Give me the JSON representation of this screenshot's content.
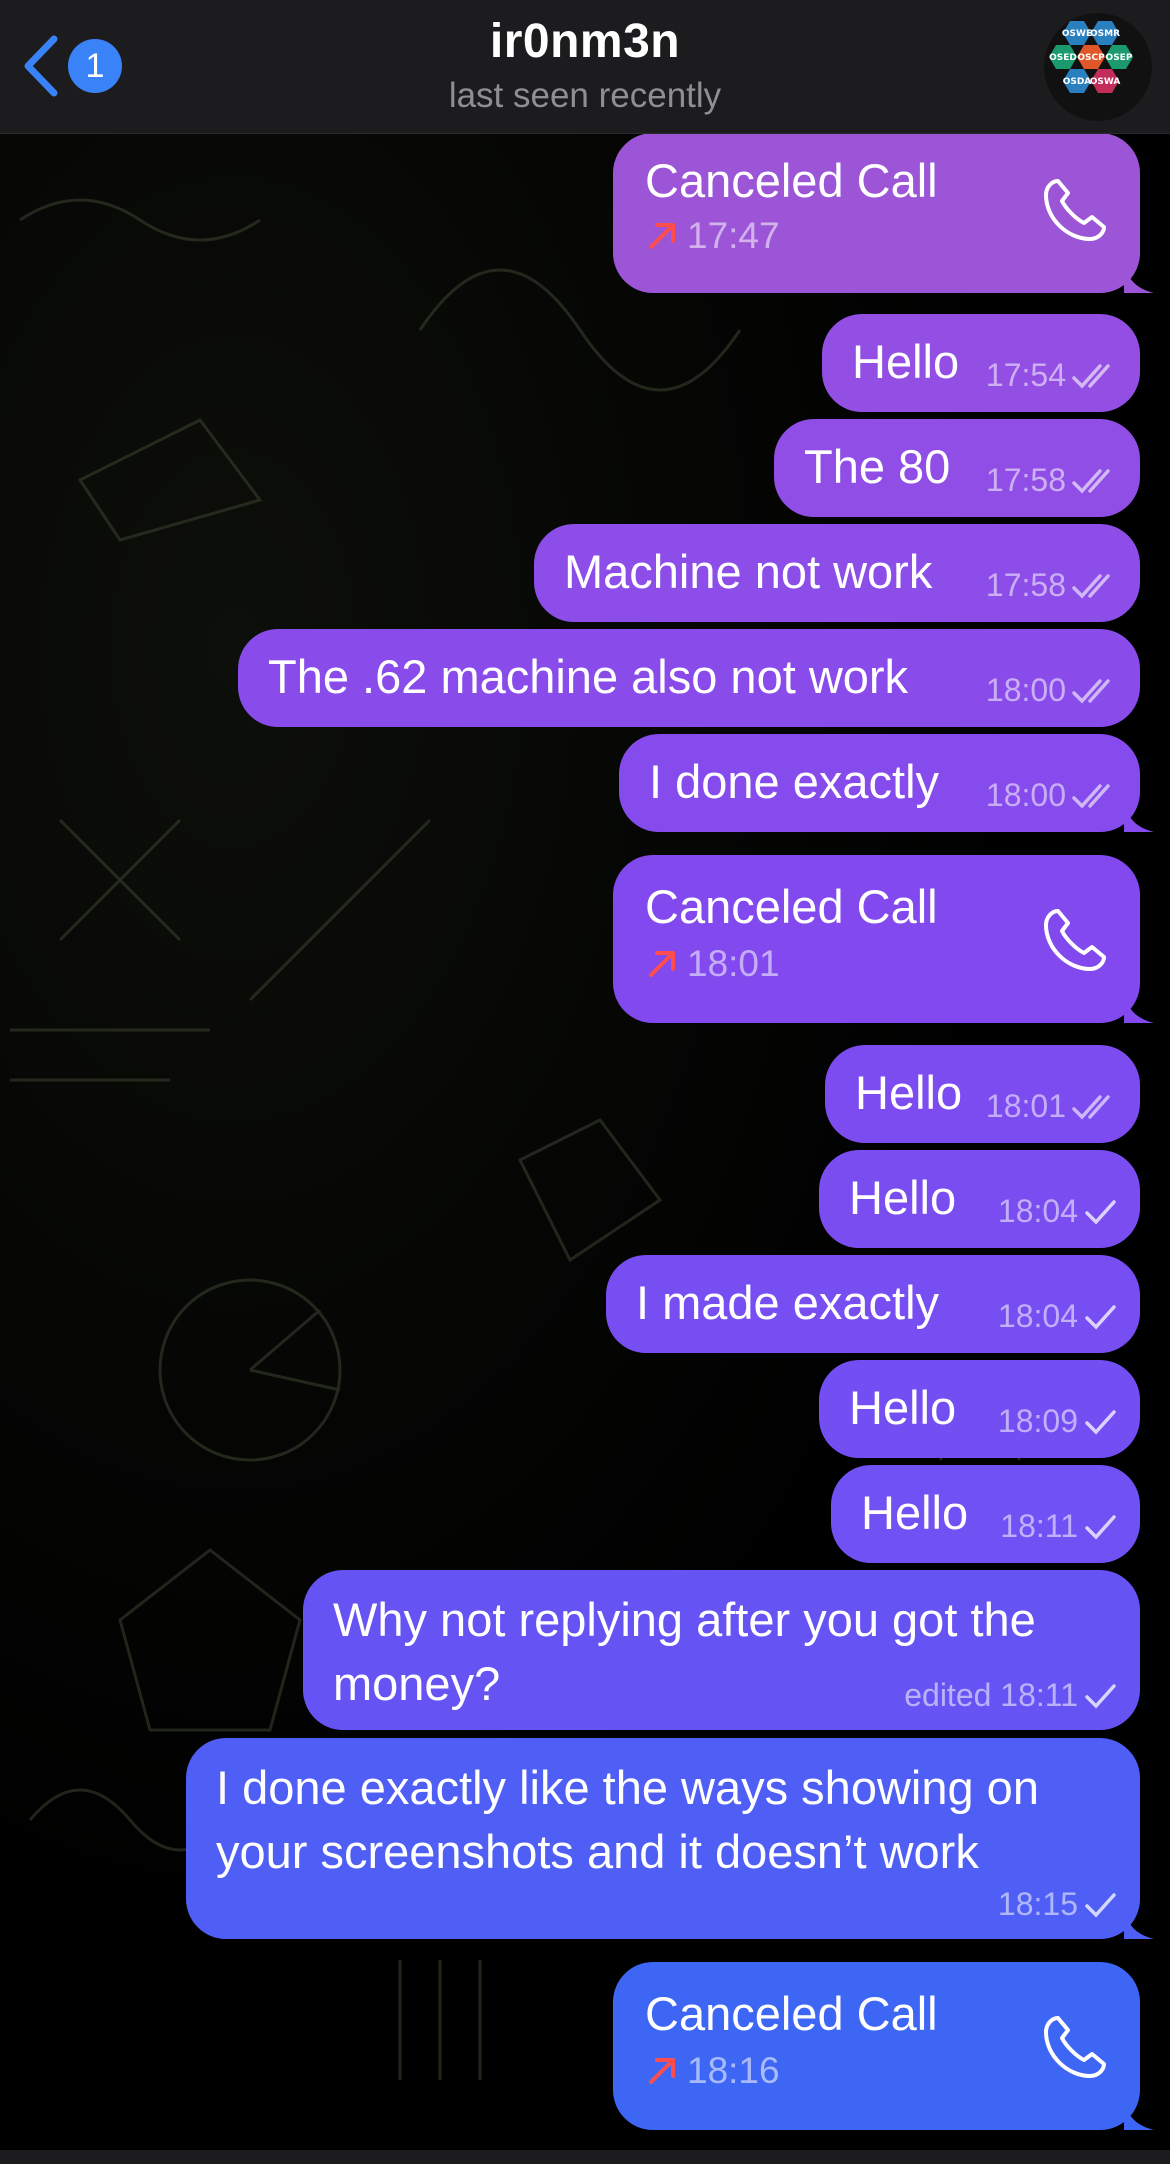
{
  "header": {
    "back_badge": "1",
    "title": "ir0nm3n",
    "subtitle": "last seen recently",
    "avatar_labels": [
      "OSWE",
      "OSMR",
      "OSED",
      "OSCP",
      "OSEP",
      "OSDA",
      "OSWA"
    ]
  },
  "messages": [
    {
      "type": "call",
      "title": "Canceled Call",
      "time": "17:47",
      "color": "#9b59d8"
    },
    {
      "type": "text",
      "text": "Hello",
      "time": "17:54",
      "status": "read"
    },
    {
      "type": "text",
      "text": "The 80",
      "time": "17:58",
      "status": "read"
    },
    {
      "type": "text",
      "text": "Machine not work",
      "time": "17:58",
      "status": "read"
    },
    {
      "type": "text",
      "text": "The .62 machine also not work",
      "time": "18:00",
      "status": "read"
    },
    {
      "type": "text",
      "text": "I done exactly",
      "time": "18:00",
      "status": "read"
    },
    {
      "type": "call",
      "title": "Canceled Call",
      "time": "18:01"
    },
    {
      "type": "text",
      "text": "Hello",
      "time": "18:01",
      "status": "read"
    },
    {
      "type": "text",
      "text": "Hello",
      "time": "18:04",
      "status": "sent"
    },
    {
      "type": "text",
      "text": "I made exactly",
      "time": "18:04",
      "status": "sent"
    },
    {
      "type": "text",
      "text": "Hello",
      "time": "18:09",
      "status": "sent"
    },
    {
      "type": "text",
      "text": "Hello",
      "time": "18:11",
      "status": "sent"
    },
    {
      "type": "text",
      "text": "Why not replying after you got the money?",
      "time": "edited 18:11",
      "status": "sent"
    },
    {
      "type": "text",
      "text": "I done exactly like the ways showing on your screenshots and it doesn’t work",
      "time": "18:15",
      "status": "sent"
    },
    {
      "type": "call",
      "title": "Canceled Call",
      "time": "18:16"
    }
  ],
  "colors": {
    "header_bg": "#1c1c1e",
    "accent": "#3a82f7",
    "bubble_top": "#9b59d8",
    "bubble_mid": "#7a4ef5",
    "bubble_bottom": "#3d6bf5",
    "missed_arrow": "#ff4d4d"
  },
  "icons": {
    "back": "chevron-left-icon",
    "phone": "phone-icon",
    "outgoing": "outgoing-call-arrow-icon",
    "read": "double-check-icon",
    "sent": "single-check-icon"
  }
}
